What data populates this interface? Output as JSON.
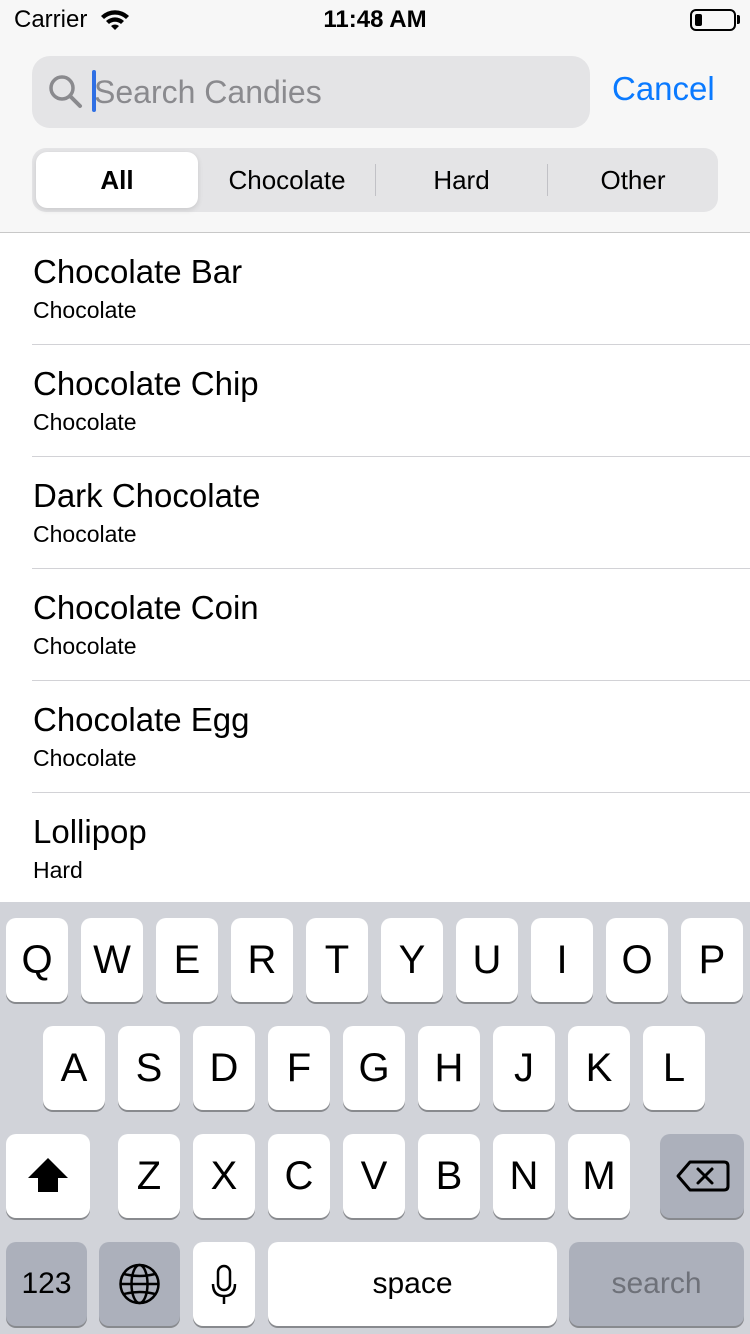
{
  "status_bar": {
    "carrier": "Carrier",
    "time": "11:48 AM",
    "battery_level": 0.2
  },
  "search": {
    "placeholder": "Search Candies",
    "value": "",
    "cancel_label": "Cancel"
  },
  "scope_bar": {
    "segments": [
      "All",
      "Chocolate",
      "Hard",
      "Other"
    ],
    "selected": "All"
  },
  "candies": [
    {
      "name": "Chocolate Bar",
      "category": "Chocolate"
    },
    {
      "name": "Chocolate Chip",
      "category": "Chocolate"
    },
    {
      "name": "Dark Chocolate",
      "category": "Chocolate"
    },
    {
      "name": "Chocolate Coin",
      "category": "Chocolate"
    },
    {
      "name": "Chocolate Egg",
      "category": "Chocolate"
    },
    {
      "name": "Lollipop",
      "category": "Hard"
    }
  ],
  "keyboard": {
    "row1": [
      "Q",
      "W",
      "E",
      "R",
      "T",
      "Y",
      "U",
      "I",
      "O",
      "P"
    ],
    "row2": [
      "A",
      "S",
      "D",
      "F",
      "G",
      "H",
      "J",
      "K",
      "L"
    ],
    "row3": [
      "Z",
      "X",
      "C",
      "V",
      "B",
      "N",
      "M"
    ],
    "numbers_label": "123",
    "space_label": "space",
    "return_label": "search"
  },
  "colors": {
    "accent": "#0a7aff",
    "keyboard_bg": "#d1d3d9",
    "key_dark": "#acb0bb"
  },
  "icons": [
    "wifi-icon",
    "battery-icon",
    "search-icon",
    "shift-icon",
    "backspace-icon",
    "globe-icon",
    "microphone-icon"
  ]
}
